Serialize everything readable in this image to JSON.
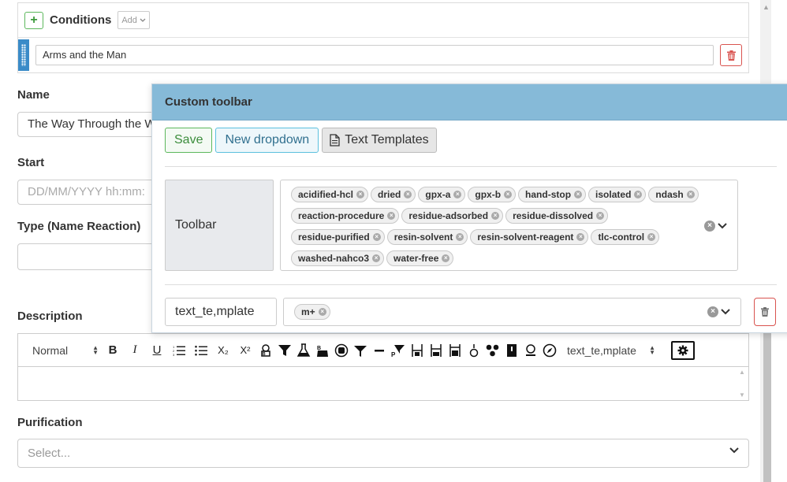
{
  "conditions": {
    "title": "Conditions",
    "add_label": "Add",
    "row_value": "Arms and the Man"
  },
  "form": {
    "name_label": "Name",
    "name_value": "The Way Through the W",
    "start_label": "Start",
    "start_placeholder": "DD/MM/YYYY hh:mm:",
    "type_label": "Type (Name Reaction)",
    "description_label": "Description",
    "purification_label": "Purification",
    "purification_placeholder": "Select..."
  },
  "editor": {
    "format_value": "Normal",
    "template_value": "text_te,mplate",
    "buttons": [
      "B",
      "I",
      "U"
    ],
    "icons": [
      "ordered-list-icon",
      "bullet-list-icon",
      "subscript-icon",
      "superscript-icon",
      "reagent-icon",
      "funnel-icon",
      "flask-icon",
      "flask-alt-icon",
      "solid-icon",
      "funnel-alt-icon",
      "dash-icon",
      "filter-paper-icon",
      "column-icon",
      "column-alt-icon",
      "column-third-icon",
      "burner-icon",
      "molecule-icon",
      "notebook-icon",
      "pellet-icon",
      "compass-icon"
    ],
    "subscript_label": "X₂",
    "superscript_label": "X²"
  },
  "modal": {
    "title": "Custom toolbar",
    "save_label": "Save",
    "new_dropdown_label": "New dropdown",
    "text_templates_label": "Text Templates",
    "toolbar_label": "Toolbar",
    "toolbar_tags": [
      "acidified-hcl",
      "dried",
      "gpx-a",
      "gpx-b",
      "hand-stop",
      "isolated",
      "ndash",
      "reaction-procedure",
      "residue-adsorbed",
      "residue-dissolved",
      "residue-purified",
      "resin-solvent",
      "resin-solvent-reagent",
      "tlc-control",
      "washed-nahco3",
      "water-free"
    ],
    "template_name": "text_te,mplate",
    "template_tags": [
      "m+"
    ]
  },
  "colors": {
    "modal_header": "#86bad8",
    "save_green": "#5cb85c",
    "new_blue": "#5bc0de",
    "danger_red": "#d9534f",
    "drag_handle": "#3a8bc8"
  }
}
